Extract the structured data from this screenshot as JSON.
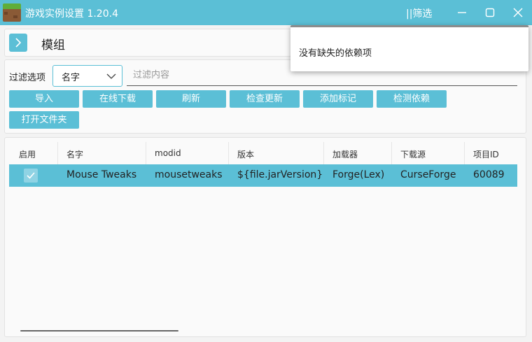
{
  "window": {
    "title": "游戏实例设置 1.20.4",
    "filter_toggle": "||筛选"
  },
  "header": {
    "title": "模组"
  },
  "filter": {
    "label": "过滤选项",
    "selected": "名字",
    "placeholder": "过滤内容"
  },
  "actions": {
    "import": "导入",
    "online_download": "在线下载",
    "refresh": "刷新",
    "check_updates": "检查更新",
    "add_tag": "添加标记",
    "check_dependencies": "检测依赖",
    "open_folder": "打开文件夹"
  },
  "table": {
    "columns": [
      "启用",
      "名字",
      "modid",
      "版本",
      "加载器",
      "下载源",
      "项目ID"
    ],
    "rows": [
      {
        "enabled": true,
        "name": "Mouse Tweaks",
        "modid": "mousetweaks",
        "version": "${file.jarVersion}",
        "loader": "Forge(Lex)",
        "source": "CurseForge",
        "project_id": "60089"
      }
    ]
  },
  "popup": {
    "message": "没有缺失的依赖项"
  },
  "colors": {
    "accent": "#5bbfd6",
    "panel": "#fafafa",
    "background": "#f3f3f3"
  }
}
